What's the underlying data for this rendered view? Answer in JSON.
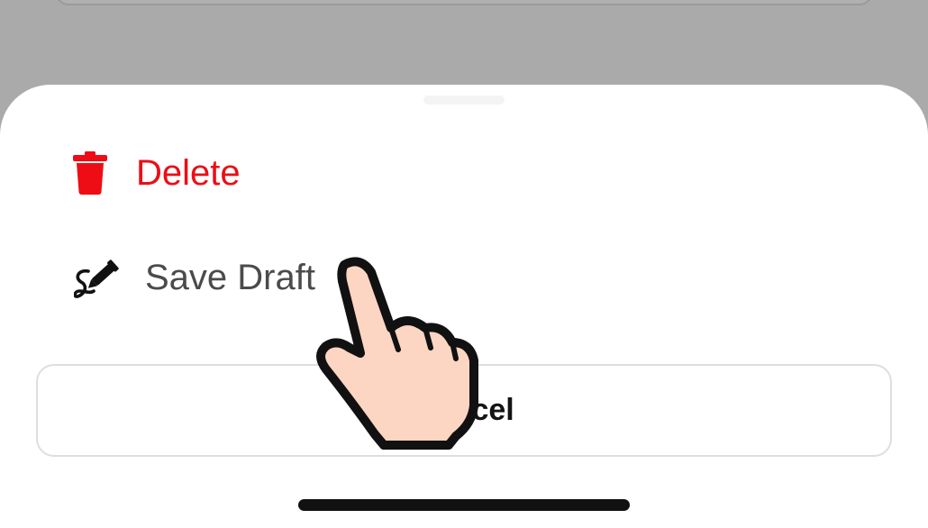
{
  "action_sheet": {
    "actions": [
      {
        "label": "Delete",
        "icon": "trash-icon",
        "color": "#ee0d14"
      },
      {
        "label": "Save Draft",
        "icon": "pen-draft-icon",
        "color": "#4b4b4d"
      }
    ],
    "cancel_label": "Cancel"
  },
  "overlay": {
    "icon": "tap-hand-icon"
  },
  "colors": {
    "destructive": "#ee0d14",
    "backdrop": "#aaaaab",
    "sheet": "#ffffff"
  }
}
